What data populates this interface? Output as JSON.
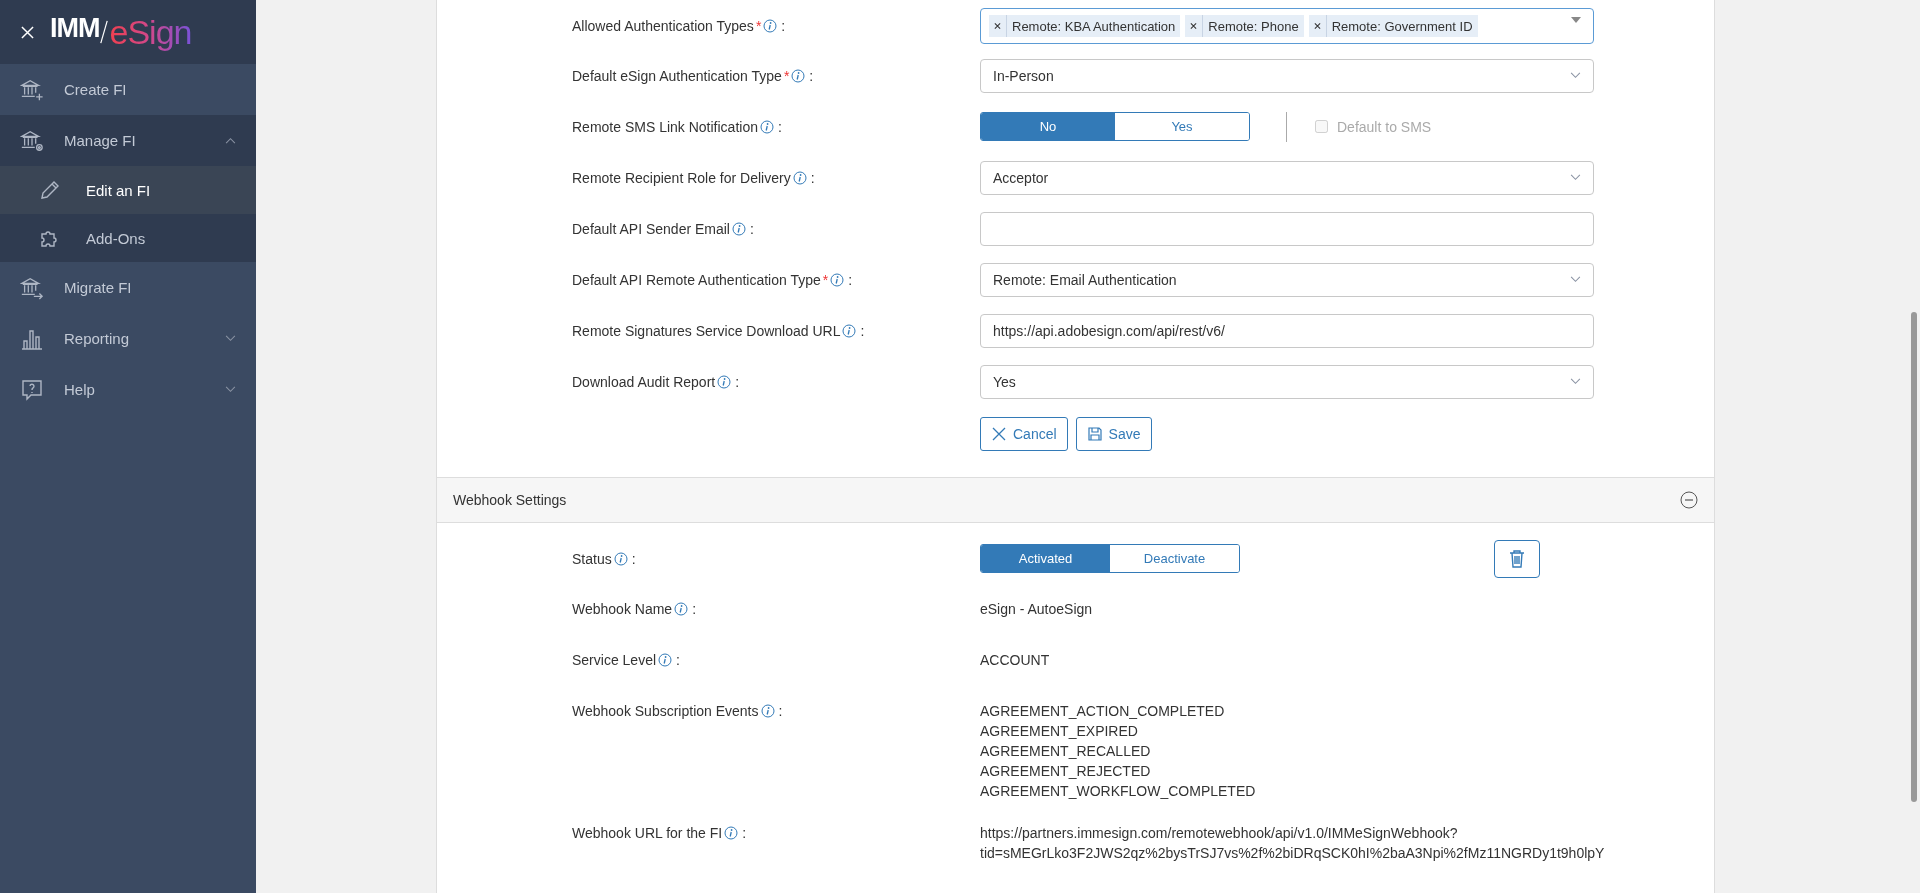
{
  "sidebar": {
    "logo": {
      "prefix": "IMM",
      "accent": "eSign"
    },
    "items": [
      {
        "label": "Create FI",
        "selected": false
      },
      {
        "label": "Manage FI",
        "selected": false,
        "expanded": true,
        "children": [
          {
            "label": "Edit an FI",
            "selected": true
          },
          {
            "label": "Add-Ons",
            "selected": false
          }
        ]
      },
      {
        "label": "Migrate FI",
        "selected": false
      },
      {
        "label": "Reporting",
        "selected": false,
        "expanded": false
      },
      {
        "label": "Help",
        "selected": false,
        "expanded": false
      }
    ]
  },
  "form": {
    "fields": [
      {
        "kind": "multiselect",
        "label": "Allowed Authentication Types",
        "required_mark": "*",
        "colon": ":",
        "chips": [
          "Remote: KBA Authentication",
          "Remote: Phone",
          "Remote: Government ID"
        ]
      },
      {
        "kind": "select",
        "label": "Default eSign Authentication Type",
        "required_mark": "*",
        "colon": ":",
        "value": "In-Person"
      },
      {
        "kind": "toggle",
        "label": "Remote SMS Link Notification",
        "colon": ":",
        "options": [
          {
            "label": "No",
            "selected": true
          },
          {
            "label": "Yes",
            "selected": false
          }
        ],
        "checkbox": {
          "label": "Default to SMS",
          "checked": false,
          "disabled": true
        }
      },
      {
        "kind": "select",
        "label": "Remote Recipient Role for Delivery",
        "colon": ":",
        "value": "Acceptor"
      },
      {
        "kind": "input",
        "label": "Default API Sender Email",
        "colon": ":"
      },
      {
        "kind": "select",
        "label": "Default API Remote Authentication Type",
        "required_mark": "*",
        "colon": ":",
        "value": "Remote: Email Authentication"
      },
      {
        "kind": "input",
        "label": "Remote Signatures Service Download URL",
        "colon": ":",
        "value": "https://api.adobesign.com/api/rest/v6/"
      },
      {
        "kind": "select",
        "label": "Download Audit Report",
        "colon": ":",
        "value": "Yes"
      }
    ],
    "buttons": [
      {
        "kind": "cancel",
        "label": "Cancel"
      },
      {
        "kind": "save",
        "label": "Save"
      }
    ]
  },
  "webhook": {
    "title": "Webhook Settings",
    "expanded": true,
    "status": {
      "label": "Status",
      "colon": ":",
      "options": [
        {
          "label": "Activated",
          "selected": true
        },
        {
          "label": "Deactivate",
          "selected": false
        }
      ]
    },
    "details": [
      {
        "label": "Webhook Name",
        "colon": ":",
        "lines": [
          "eSign - AutoeSign"
        ]
      },
      {
        "label": "Service Level",
        "colon": ":",
        "lines": [
          "ACCOUNT"
        ]
      },
      {
        "label": "Webhook Subscription Events",
        "colon": ":",
        "lines": [
          "AGREEMENT_ACTION_COMPLETED",
          "AGREEMENT_EXPIRED",
          "AGREEMENT_RECALLED",
          "AGREEMENT_REJECTED",
          "AGREEMENT_WORKFLOW_COMPLETED"
        ]
      },
      {
        "label": "Webhook URL for the FI",
        "colon": ":",
        "lines": [
          "https://partners.immesign.com/remotewebhook/api/v1.0/IMMeSignWebhook?",
          "tid=sMEGrLko3F2JWS2qz%2bysTrSJ7vs%2f%2biDRqSCK0hI%2baA3Npi%2fMz11NGRDy1t9h0lpY"
        ]
      }
    ]
  }
}
